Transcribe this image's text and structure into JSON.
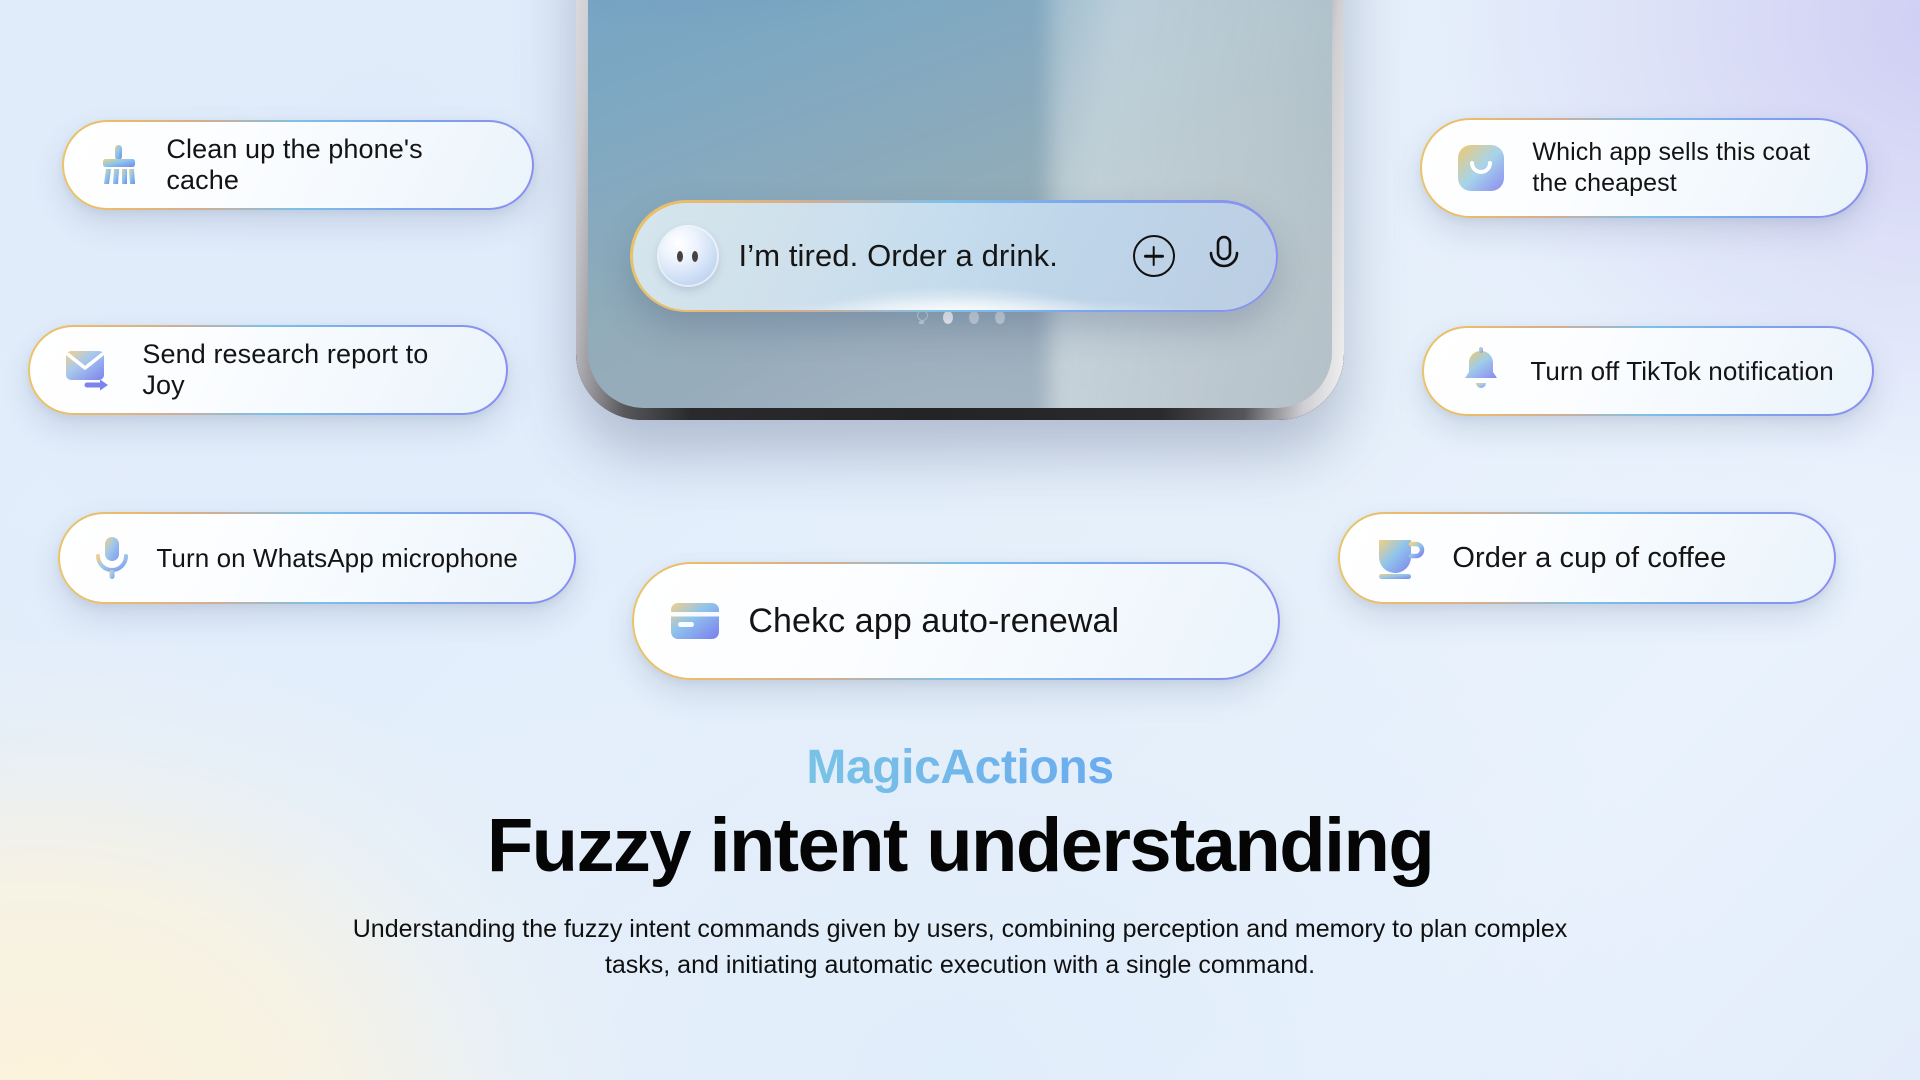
{
  "phone": {
    "page_indicator": {
      "items": [
        "bulb-icon",
        "dot-active",
        "dot",
        "dot"
      ]
    }
  },
  "assistant": {
    "avatar_icon": "assistant-face-icon",
    "query_text": "I’m tired. Order a drink.",
    "add_label": "plus-icon",
    "mic_label": "microphone-icon"
  },
  "cards": {
    "clean_cache": {
      "icon": "broom-icon",
      "label": "Clean up the phone's cache"
    },
    "send_report": {
      "icon": "mail-forward-icon",
      "label": "Send research report to Joy"
    },
    "whatsapp_mic": {
      "icon": "microphone-icon",
      "label": "Turn on WhatsApp microphone"
    },
    "check_renewal": {
      "icon": "credit-card-icon",
      "label": "Chekc app auto-renewal"
    },
    "which_app": {
      "icon": "shopping-bag-icon",
      "label_line1": "Which app sells this coat",
      "label_line2": "the cheapest"
    },
    "tiktok": {
      "icon": "bell-icon",
      "label": "Turn off TikTok notification"
    },
    "coffee": {
      "icon": "coffee-cup-icon",
      "label": "Order a cup of coffee"
    }
  },
  "footer": {
    "brand": "MagicActions",
    "headline": "Fuzzy intent understanding",
    "subcopy": "Understanding the fuzzy intent commands given by users, combining perception and memory to plan complex tasks, and initiating automatic execution with a single command."
  },
  "colors": {
    "gradient_start": "#e9c468",
    "gradient_mid": "#7dc0e9",
    "gradient_end": "#8a8df0",
    "headline": "#050505",
    "background_warm": "#fdf3d9",
    "background_cool": "#dfeaf8"
  }
}
